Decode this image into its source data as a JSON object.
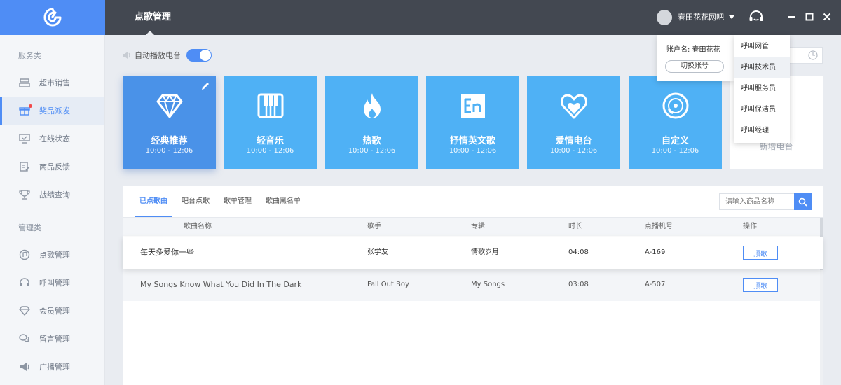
{
  "colors": {
    "accent": "#4f8df5",
    "topbar": "#434851",
    "card": "#4fb1f5",
    "card_featured": "#4a92e8"
  },
  "topbar": {
    "title": "点歌管理",
    "user_name": "春田花花网吧"
  },
  "sidebar": {
    "section1": "服务类",
    "items1": [
      {
        "label": "超市销售",
        "icon": "register-icon"
      },
      {
        "label": "奖品派发",
        "icon": "gift-icon"
      },
      {
        "label": "在线状态",
        "icon": "monitor-icon"
      },
      {
        "label": "商品反馈",
        "icon": "edit-doc-icon"
      },
      {
        "label": "战绩查询",
        "icon": "trophy-icon"
      }
    ],
    "section2": "管理类",
    "items2": [
      {
        "label": "点歌管理",
        "icon": "music-disc-icon"
      },
      {
        "label": "呼叫管理",
        "icon": "headset-icon"
      },
      {
        "label": "会员管理",
        "icon": "diamond-icon"
      },
      {
        "label": "留言管理",
        "icon": "chat-icon"
      },
      {
        "label": "广播管理",
        "icon": "megaphone-icon"
      }
    ]
  },
  "autoplay": {
    "label": "自动播放电台",
    "enabled": true
  },
  "cards": [
    {
      "name": "经典推荐",
      "time": "10:00 - 12:06",
      "icon": "diamond-icon"
    },
    {
      "name": "轻音乐",
      "time": "10:00 - 12:06",
      "icon": "piano-icon"
    },
    {
      "name": "热歌",
      "time": "10:00 - 12:06",
      "icon": "flame-icon"
    },
    {
      "name": "抒情英文歌",
      "time": "10:00 - 12:06",
      "icon": "en-icon"
    },
    {
      "name": "爱情电台",
      "time": "10:00 - 12:06",
      "icon": "heart-icon"
    },
    {
      "name": "自定义",
      "time": "10:00 - 12:06",
      "icon": "disc-icon"
    }
  ],
  "add_card": {
    "label": "新增电台"
  },
  "account_dropdown": {
    "label": "账户名: 春田花花",
    "switch_label": "切换账号"
  },
  "call_dropdown": {
    "items": [
      "呼叫网管",
      "呼叫技术员",
      "呼叫服务员",
      "呼叫保洁员",
      "呼叫经理"
    ]
  },
  "panel": {
    "tabs": [
      "已点歌曲",
      "吧台点歌",
      "歌单管理",
      "歌曲黑名单"
    ],
    "search_placeholder": "请输入商品名称",
    "columns": [
      "歌曲名称",
      "歌手",
      "专辑",
      "时长",
      "点播机号",
      "操作"
    ],
    "rows": [
      {
        "song": "每天多爱你一些",
        "artist": "张学友",
        "album": "情歌岁月",
        "duration": "04:08",
        "machine": "A-169",
        "action": "顶歌"
      },
      {
        "song": "My Songs Know What You Did In The Dark",
        "artist": "Fall Out Boy",
        "album": "My Songs",
        "duration": "03:08",
        "machine": "A-507",
        "action": "顶歌"
      }
    ]
  }
}
